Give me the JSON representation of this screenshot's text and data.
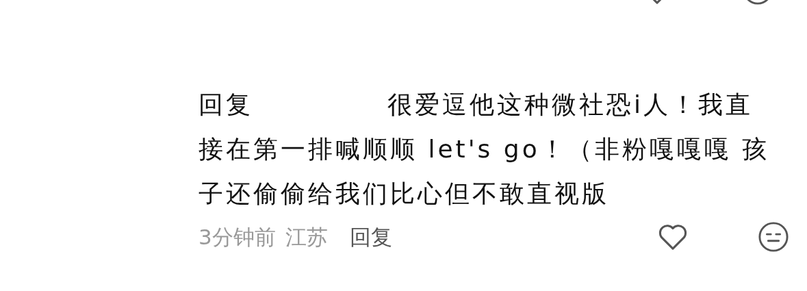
{
  "previous_actions": {
    "liked": false
  },
  "reply": {
    "prefix": "回复",
    "text": "很爱逗他这种微社恐i人！我直接在第一排喊顺顺 let's go！（非粉嘎嘎嘎 孩子还偷偷给我们比心但不敢直视版",
    "time": "3分钟前",
    "location": "江苏",
    "reply_button": "回复",
    "liked": false
  }
}
